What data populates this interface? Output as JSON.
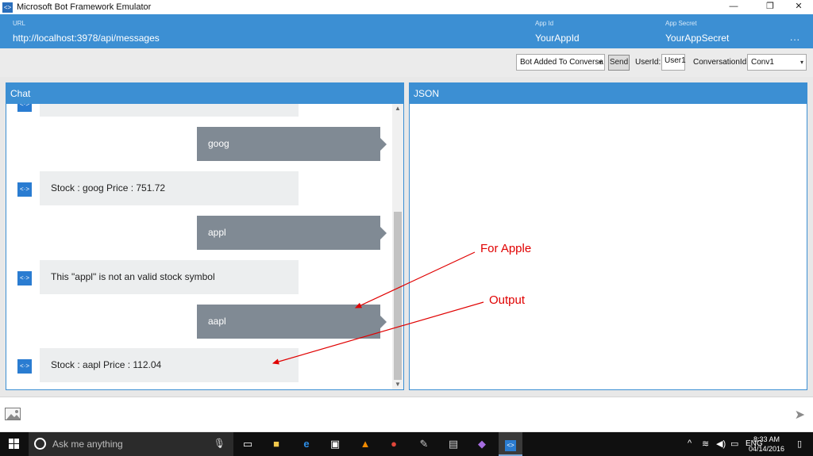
{
  "window": {
    "title": "Microsoft Bot Framework Emulator",
    "minimize": "—",
    "restore": "❐",
    "close": "✕"
  },
  "header": {
    "url_label": "URL",
    "url_value": "http://localhost:3978/api/messages",
    "appid_label": "App Id",
    "appid_value": "YourAppId",
    "appsecret_label": "App Secret",
    "appsecret_value": "YourAppSecret",
    "more": "..."
  },
  "toolbar": {
    "activity_select": "Bot Added To Conversa",
    "send_label": "Send",
    "userid_label": "UserId:",
    "userid_value": "User1",
    "conversationid_label": "ConversationId:",
    "conversationid_value": "Conv1"
  },
  "chat": {
    "title": "Chat",
    "messages": [
      {
        "from": "user",
        "text": "goog"
      },
      {
        "from": "bot",
        "text": "Stock : goog Price : 751.72"
      },
      {
        "from": "user",
        "text": "appl"
      },
      {
        "from": "bot",
        "text": "This \"appl\" is not an valid stock symbol"
      },
      {
        "from": "user",
        "text": "aapl"
      },
      {
        "from": "bot",
        "text": "Stock : aapl Price : 112.04"
      }
    ]
  },
  "json_panel": {
    "title": "JSON"
  },
  "annotations": {
    "for_apple": "For Apple",
    "output": "Output",
    "color": "#e00000"
  },
  "taskbar": {
    "search_placeholder": "Ask me anything",
    "language": "ENG",
    "time": "8:33 AM",
    "date": "04/14/2016"
  },
  "colors": {
    "accent": "#3c8fd3",
    "user_bubble": "#808a94",
    "bot_bubble": "#eceeef"
  }
}
